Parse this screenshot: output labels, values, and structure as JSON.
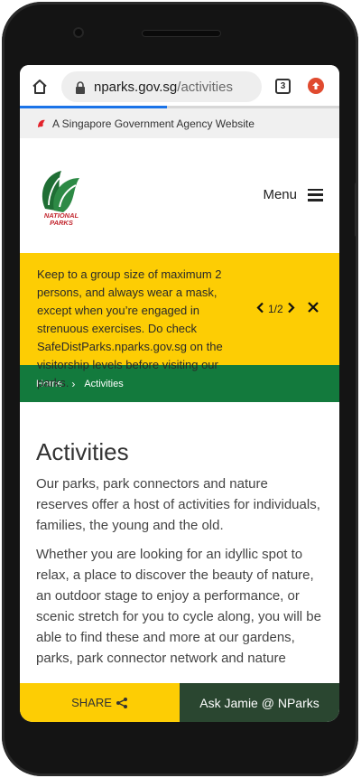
{
  "browser": {
    "url_host": "nparks.gov.sg",
    "url_path": "/activities",
    "tab_count": "3",
    "load_progress": 0.46
  },
  "gov_banner": {
    "text": "A Singapore Government Agency Website"
  },
  "header": {
    "logo_text_line1": "NATIONAL",
    "logo_text_line2": "PARKS",
    "menu_label": "Menu"
  },
  "notice": {
    "text": "Keep to a group size of maximum 2 persons, and always wear a mask, except when you’re engaged in strenuous exercises. Do check SafeDistParks.nparks.gov.sg on the visitorship levels before visiting our parks.",
    "pager": "1/2"
  },
  "breadcrumb": {
    "home": "Home",
    "current": "Activities"
  },
  "main": {
    "title": "Activities",
    "paragraphs": [
      "Our parks, park connectors and nature reserves offer a host of activities for individuals, families, the young and the old.",
      "Whether you are looking for an idyllic spot to relax, a place to discover the beauty of nature, an outdoor stage to enjoy a performance, or scenic stretch for you to cycle along, you will be able to find these and more at our gardens, parks, park connector network and nature"
    ]
  },
  "bottom_bar": {
    "share_label": "SHARE",
    "ask_label": "Ask Jamie @ NParks"
  },
  "colors": {
    "notice_bg": "#fdcd04",
    "breadcrumb_bg": "#137a3d",
    "ask_bg": "#2a4630",
    "logo_red": "#c2262e"
  }
}
